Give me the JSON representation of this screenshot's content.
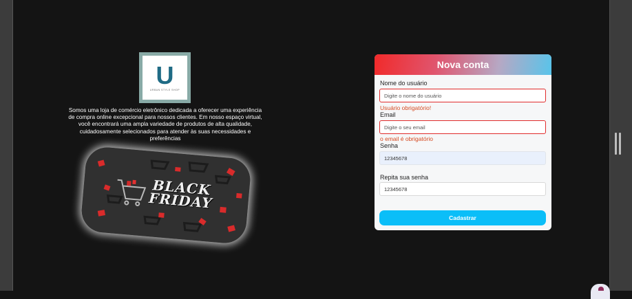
{
  "brand": {
    "logo_letter": "U",
    "logo_tagline": "URBAN STYLE SHOP",
    "about": "Somos uma loja de comércio eletrônico dedicada a oferecer uma experiência de compra online excepcional para nossos clientes. Em nosso espaço virtual, você encontrará uma ampla variedade de produtos de alta qualidade, cuidadosamente selecionados para atender às suas necessidades e preferências"
  },
  "promo": {
    "line1": "BLACK",
    "line2": "FRIDAY"
  },
  "form": {
    "title": "Nova conta",
    "username": {
      "label": "Nome do usuário",
      "placeholder": "Digite o nome do usuário",
      "value": "",
      "error": "Usuário obrigatório!"
    },
    "email": {
      "label": "Email",
      "placeholder": "Digite o seu email",
      "value": "",
      "error": "o email é obrigatório"
    },
    "password": {
      "label": "Senha",
      "value": "12345678"
    },
    "confirm_password": {
      "label": "Repita sua senha",
      "value": "12345678"
    },
    "submit_label": "Cadastrar"
  },
  "colors": {
    "accent_button": "#0bbef8",
    "error_text": "#d64a21",
    "invalid_border": "#e02a2a",
    "header_gradient_start": "#f12a2a",
    "header_gradient_end": "#58c4ea"
  }
}
